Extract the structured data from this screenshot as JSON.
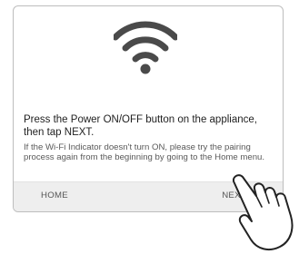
{
  "wifi_icon": "wifi-icon",
  "hand_icon": "pointing-hand-icon",
  "message": {
    "title": "Press the Power ON/OFF button on the appliance, then tap NEXT.",
    "description": "If the Wi-Fi Indicator doesn't turn ON, please try the pairing process again from the beginning by going to the Home menu."
  },
  "footer": {
    "home_label": "HOME",
    "next_label": "NEXT"
  },
  "colors": {
    "icon": "#4a4a4a",
    "footer_bg": "#eeeeee",
    "border": "#bdbdbd"
  }
}
